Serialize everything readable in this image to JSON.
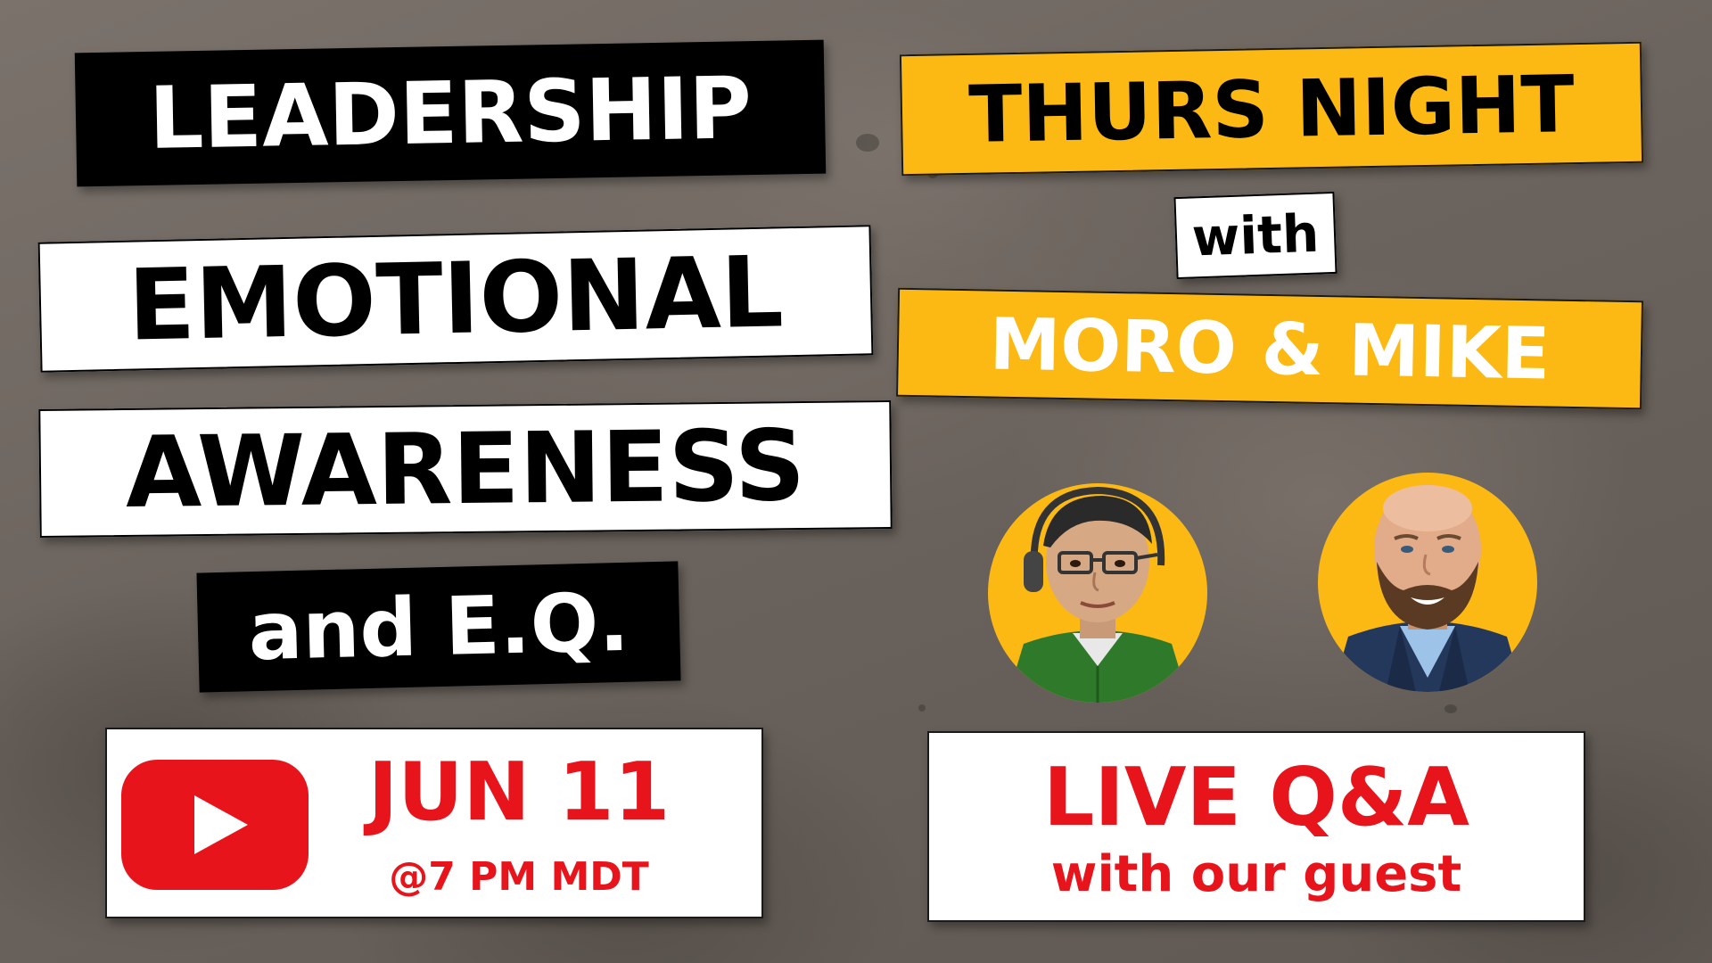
{
  "left_column": {
    "title": "LEADERSHIP",
    "line_1": "EMOTIONAL",
    "line_2": "AWARENESS",
    "line_3": "and E.Q."
  },
  "right_column": {
    "show_name": "THURS NIGHT",
    "connector": "with",
    "hosts": "MORO & MIKE"
  },
  "schedule": {
    "platform_icon": "youtube-play-icon",
    "date": "JUN 11",
    "time": "@7 PM MDT"
  },
  "qa": {
    "headline": "LIVE Q&A",
    "subline": "with our guest"
  },
  "colors": {
    "accent_yellow": "#fdb913",
    "youtube_red": "#e8141c",
    "banner_black": "#000000",
    "background_concrete": "#6e6660"
  }
}
